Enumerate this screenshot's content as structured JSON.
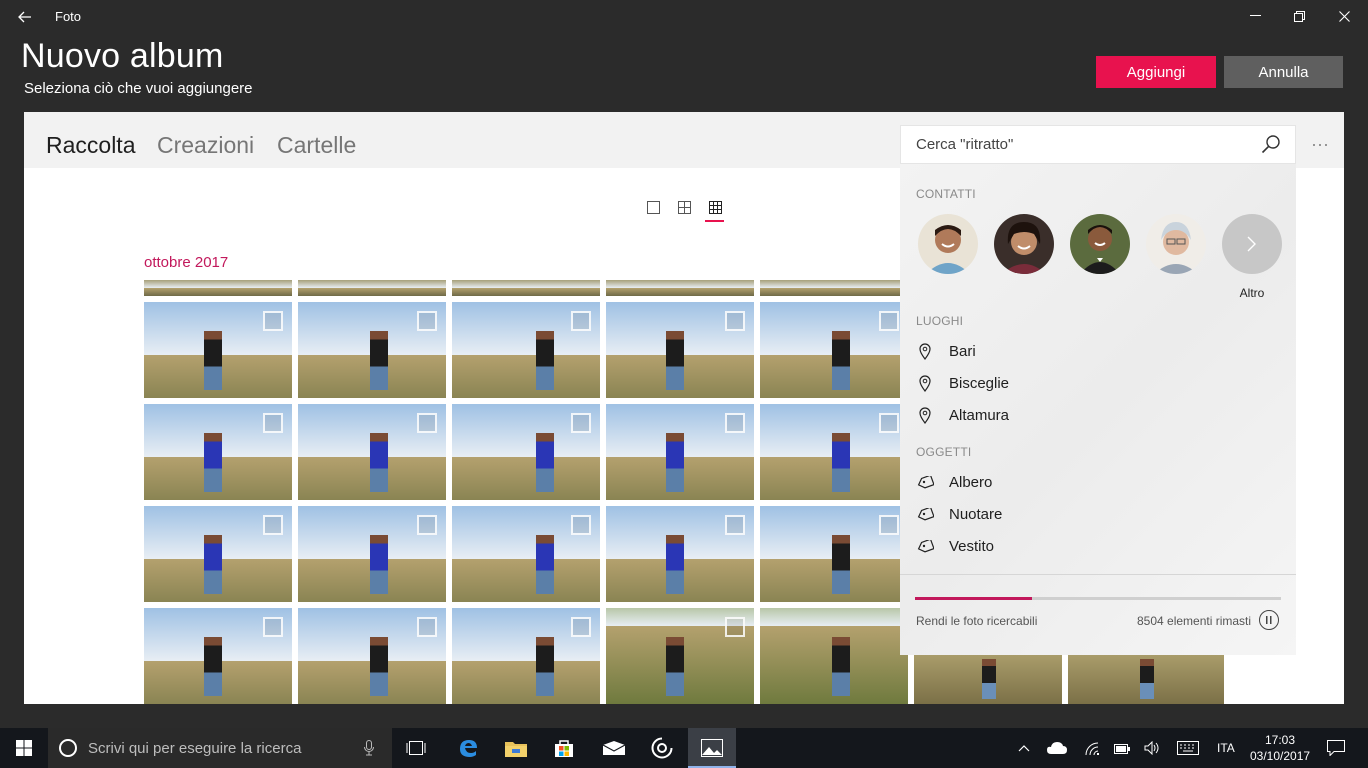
{
  "window": {
    "app_title": "Foto",
    "back_icon": "back-arrow-icon",
    "controls": [
      "minimize-icon",
      "restore-icon",
      "close-icon"
    ]
  },
  "header": {
    "title": "Nuovo album",
    "subtitle": "Seleziona ciò che vuoi aggiungere",
    "add_label": "Aggiungi",
    "cancel_label": "Annulla",
    "accent_color": "#e8124e"
  },
  "tabs": [
    {
      "label": "Raccolta",
      "active": true
    },
    {
      "label": "Creazioni",
      "active": false
    },
    {
      "label": "Cartelle",
      "active": false
    }
  ],
  "more_label": "···",
  "view_modes": [
    "single-view-icon",
    "medium-grid-view-icon",
    "small-grid-view-icon"
  ],
  "active_view": "small-grid-view-icon",
  "month_label": "ottobre 2017",
  "search": {
    "placeholder": "Cerca \"ritratto\"",
    "icon": "search-icon"
  },
  "dropdown": {
    "contacts_label": "CONTATTI",
    "contacts_count": 4,
    "more_contacts_label": "Altro",
    "places_label": "LUOGHI",
    "places": [
      "Bari",
      "Bisceglie",
      "Altamura"
    ],
    "objects_label": "OGGETTI",
    "objects": [
      "Albero",
      "Nuotare",
      "Vestito"
    ],
    "progress_label": "Rendi le foto ricercabili",
    "remaining_label": "8504 elementi rimasti",
    "progress_fraction": 0.32,
    "progress_color": "#c2185b"
  },
  "taskbar": {
    "search_placeholder": "Scrivi qui per eseguire la ricerca",
    "language": "ITA",
    "time": "17:03",
    "date": "03/10/2017",
    "apps": [
      "task-view-icon",
      "edge-icon",
      "file-explorer-icon",
      "store-icon",
      "mail-icon",
      "groove-icon",
      "photos-icon"
    ]
  }
}
